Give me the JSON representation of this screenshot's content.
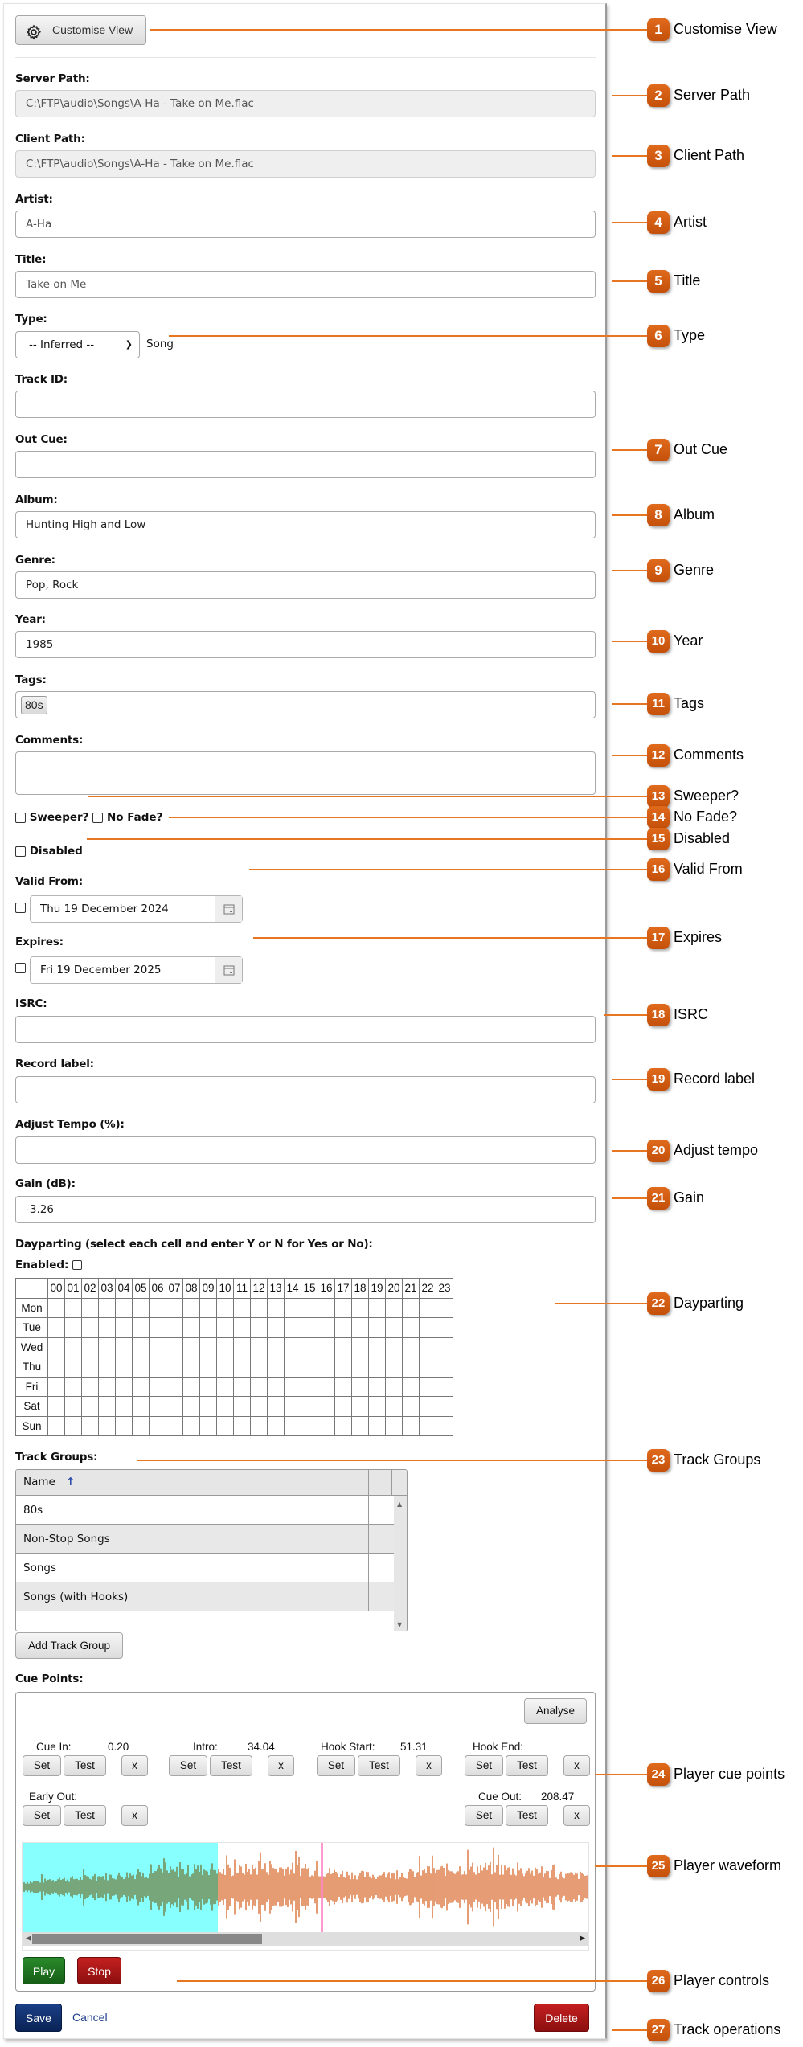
{
  "toolbar": {
    "customise_view_label": "Customise View",
    "customise_view_icon": "gear-icon"
  },
  "fields": {
    "server_path": {
      "label": "Server Path:",
      "value": "C:\\FTP\\audio\\Songs\\A-Ha - Take on Me.flac"
    },
    "client_path": {
      "label": "Client Path:",
      "value": "C:\\FTP\\audio\\Songs\\A-Ha - Take on Me.flac"
    },
    "artist": {
      "label": "Artist:",
      "value": "A-Ha"
    },
    "title": {
      "label": "Title:",
      "value": "Take on Me"
    },
    "type": {
      "label": "Type:",
      "selected": "-- Inferred --",
      "inferred_value": "Song"
    },
    "track_id": {
      "label": "Track ID:",
      "value": ""
    },
    "out_cue": {
      "label": "Out Cue:",
      "value": ""
    },
    "album": {
      "label": "Album:",
      "value": "Hunting High and Low"
    },
    "genre": {
      "label": "Genre:",
      "value": "Pop, Rock"
    },
    "year": {
      "label": "Year:",
      "value": "1985"
    },
    "tags": {
      "label": "Tags:",
      "items": [
        "80s"
      ]
    },
    "comments": {
      "label": "Comments:",
      "value": ""
    },
    "sweeper": {
      "label": "Sweeper?",
      "checked": false
    },
    "no_fade": {
      "label": "No Fade?",
      "checked": false
    },
    "disabled": {
      "label": "Disabled",
      "checked": false
    },
    "valid_from": {
      "label": "Valid From:",
      "value": "Thu 19 December 2024",
      "checked": false
    },
    "expires": {
      "label": "Expires:",
      "value": "Fri 19 December 2025",
      "checked": false
    },
    "isrc": {
      "label": "ISRC:",
      "value": ""
    },
    "record_label": {
      "label": "Record label:",
      "value": ""
    },
    "adjust_tempo": {
      "label": "Adjust Tempo (%):",
      "value": ""
    },
    "gain": {
      "label": "Gain (dB):",
      "value": "-3.26"
    }
  },
  "dayparting": {
    "label": "Dayparting (select each cell and enter Y or N for Yes or No):",
    "enabled_label": "Enabled:",
    "enabled": false,
    "hours": [
      "00",
      "01",
      "02",
      "03",
      "04",
      "05",
      "06",
      "07",
      "08",
      "09",
      "10",
      "11",
      "12",
      "13",
      "14",
      "15",
      "16",
      "17",
      "18",
      "19",
      "20",
      "21",
      "22",
      "23"
    ],
    "days": [
      "Mon",
      "Tue",
      "Wed",
      "Thu",
      "Fri",
      "Sat",
      "Sun"
    ]
  },
  "track_groups": {
    "label": "Track Groups:",
    "column_header": "Name",
    "sort_indicator": "↑",
    "rows": [
      "80s",
      "Non-Stop Songs",
      "Songs",
      "Songs (with Hooks)"
    ],
    "add_button": "Add Track Group"
  },
  "cue_points": {
    "label": "Cue Points:",
    "analyse_button": "Analyse",
    "set_label": "Set",
    "test_label": "Test",
    "clear_label": "x",
    "points": [
      {
        "name": "Cue In:",
        "value": "0.20"
      },
      {
        "name": "Intro:",
        "value": "34.04"
      },
      {
        "name": "Hook Start:",
        "value": "51.31"
      },
      {
        "name": "Hook End:",
        "value": ""
      },
      {
        "name": "Early Out:",
        "value": ""
      },
      {
        "name": "Cue Out:",
        "value": "208.47"
      }
    ]
  },
  "waveform": {
    "intro_region_color": "#88ffff",
    "intro_wave_color": "#6b6b22",
    "wave_color": "#d65a16",
    "cursor_color": "#ff88c8",
    "scroll_position_fraction": 0.42
  },
  "player": {
    "play_label": "Play",
    "stop_label": "Stop",
    "play_color": "#1e7a1e",
    "stop_color": "#b01515"
  },
  "actions": {
    "save_label": "Save",
    "cancel_label": "Cancel",
    "delete_label": "Delete",
    "save_color": "#0d2e6b",
    "delete_color": "#b01515"
  },
  "callouts": [
    {
      "n": "1",
      "text": "Customise View"
    },
    {
      "n": "2",
      "text": "Server Path"
    },
    {
      "n": "3",
      "text": "Client Path"
    },
    {
      "n": "4",
      "text": "Artist"
    },
    {
      "n": "5",
      "text": "Title"
    },
    {
      "n": "6",
      "text": "Type"
    },
    {
      "n": "7",
      "text": "Out Cue"
    },
    {
      "n": "8",
      "text": "Album"
    },
    {
      "n": "9",
      "text": "Genre"
    },
    {
      "n": "10",
      "text": "Year"
    },
    {
      "n": "11",
      "text": "Tags"
    },
    {
      "n": "12",
      "text": "Comments"
    },
    {
      "n": "13",
      "text": "Sweeper?"
    },
    {
      "n": "14",
      "text": "No Fade?"
    },
    {
      "n": "15",
      "text": "Disabled"
    },
    {
      "n": "16",
      "text": "Valid From"
    },
    {
      "n": "17",
      "text": "Expires"
    },
    {
      "n": "18",
      "text": "ISRC"
    },
    {
      "n": "19",
      "text": "Record label"
    },
    {
      "n": "20",
      "text": "Adjust tempo"
    },
    {
      "n": "21",
      "text": "Gain"
    },
    {
      "n": "22",
      "text": "Dayparting"
    },
    {
      "n": "23",
      "text": "Track Groups"
    },
    {
      "n": "24",
      "text": "Player cue points"
    },
    {
      "n": "25",
      "text": "Player waveform"
    },
    {
      "n": "26",
      "text": "Player controls"
    },
    {
      "n": "27",
      "text": "Track operations"
    }
  ]
}
